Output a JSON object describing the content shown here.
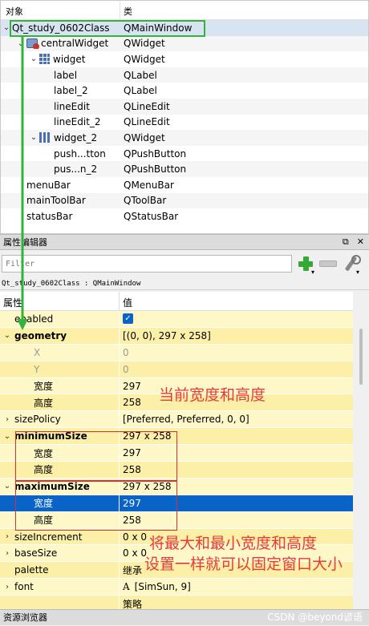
{
  "inspector": {
    "col_object": "对象",
    "col_class": "类",
    "rows": [
      {
        "name": "Qt_study_0602Class",
        "cls": "QMainWindow",
        "arrow": "v",
        "icon": ""
      },
      {
        "name": "centralWidget",
        "cls": "QWidget",
        "arrow": "v",
        "icon": "widget-icon"
      },
      {
        "name": "widget",
        "cls": "QWidget",
        "arrow": "v",
        "icon": "grid-layout-icon"
      },
      {
        "name": "label",
        "cls": "QLabel",
        "arrow": "",
        "icon": ""
      },
      {
        "name": "label_2",
        "cls": "QLabel",
        "arrow": "",
        "icon": ""
      },
      {
        "name": "lineEdit",
        "cls": "QLineEdit",
        "arrow": "",
        "icon": ""
      },
      {
        "name": "lineEdit_2",
        "cls": "QLineEdit",
        "arrow": "",
        "icon": ""
      },
      {
        "name": "widget_2",
        "cls": "QWidget",
        "arrow": "v",
        "icon": "hbox-layout-icon"
      },
      {
        "name": "push...tton",
        "cls": "QPushButton",
        "arrow": "",
        "icon": ""
      },
      {
        "name": "pus...n_2",
        "cls": "QPushButton",
        "arrow": "",
        "icon": ""
      },
      {
        "name": "menuBar",
        "cls": "QMenuBar",
        "arrow": "",
        "icon": ""
      },
      {
        "name": "mainToolBar",
        "cls": "QToolBar",
        "arrow": "",
        "icon": ""
      },
      {
        "name": "statusBar",
        "cls": "QStatusBar",
        "arrow": "",
        "icon": ""
      }
    ]
  },
  "property_editor": {
    "title": "属性编辑器",
    "title_buttons": [
      "⧉",
      "✕"
    ],
    "filter_placeholder": "Filter",
    "class_line": "Qt_study_0602Class : QMainWindow",
    "col_property": "属性",
    "col_value": "值",
    "rows": [
      {
        "name": "enabled",
        "value": "",
        "check": true,
        "arrow": "",
        "indent": false,
        "bold": false,
        "disabled": false
      },
      {
        "name": "geometry",
        "value": "[(0, 0), 297 x 258]",
        "arrow": "v",
        "indent": false,
        "bold": true,
        "disabled": false
      },
      {
        "name": "X",
        "value": "0",
        "arrow": "",
        "indent": true,
        "bold": false,
        "disabled": true
      },
      {
        "name": "Y",
        "value": "0",
        "arrow": "",
        "indent": true,
        "bold": false,
        "disabled": true
      },
      {
        "name": "宽度",
        "value": "297",
        "arrow": "",
        "indent": true,
        "bold": false,
        "disabled": false
      },
      {
        "name": "高度",
        "value": "258",
        "arrow": "",
        "indent": true,
        "bold": false,
        "disabled": false
      },
      {
        "name": "sizePolicy",
        "value": "[Preferred, Preferred, 0, 0]",
        "arrow": ">",
        "indent": false,
        "bold": false,
        "disabled": false
      },
      {
        "name": "minimumSize",
        "value": "297 x 258",
        "arrow": "v",
        "indent": false,
        "bold": true,
        "disabled": false
      },
      {
        "name": "宽度",
        "value": "297",
        "arrow": "",
        "indent": true,
        "bold": false,
        "disabled": false
      },
      {
        "name": "高度",
        "value": "258",
        "arrow": "",
        "indent": true,
        "bold": false,
        "disabled": false
      },
      {
        "name": "maximumSize",
        "value": "297 x 258",
        "arrow": "v",
        "indent": false,
        "bold": true,
        "disabled": false
      },
      {
        "name": "宽度",
        "value": "297",
        "arrow": "",
        "indent": true,
        "bold": false,
        "disabled": false,
        "selected": true
      },
      {
        "name": "高度",
        "value": "258",
        "arrow": "",
        "indent": true,
        "bold": false,
        "disabled": false
      },
      {
        "name": "sizeIncrement",
        "value": "0 x 0",
        "arrow": ">",
        "indent": false,
        "bold": false,
        "disabled": false
      },
      {
        "name": "baseSize",
        "value": "0 x 0",
        "arrow": ">",
        "indent": false,
        "bold": false,
        "disabled": false
      },
      {
        "name": "palette",
        "value": "继承",
        "arrow": "",
        "indent": false,
        "bold": false,
        "disabled": false
      },
      {
        "name": "font",
        "value": "[SimSun, 9]",
        "arrow": ">",
        "indent": false,
        "bold": false,
        "disabled": false,
        "font_icon": "A"
      },
      {
        "name": "",
        "value": "策略",
        "arrow": "",
        "indent": false,
        "bold": false,
        "disabled": false
      }
    ]
  },
  "annotations": {
    "size_note": "当前宽度和高度",
    "fix_note_line1": "将最大和最小宽度和高度",
    "fix_note_line2": "设置一样就可以固定窗口大小"
  },
  "bottom_panel": {
    "title": "资源浏览器"
  },
  "watermark": "CSDN @beyond谚语",
  "colors": {
    "selection": "#0a64c8",
    "annotation_red": "#e83a3a",
    "annotation_green": "#35b13c",
    "property_yellow": "#fef8c8"
  }
}
